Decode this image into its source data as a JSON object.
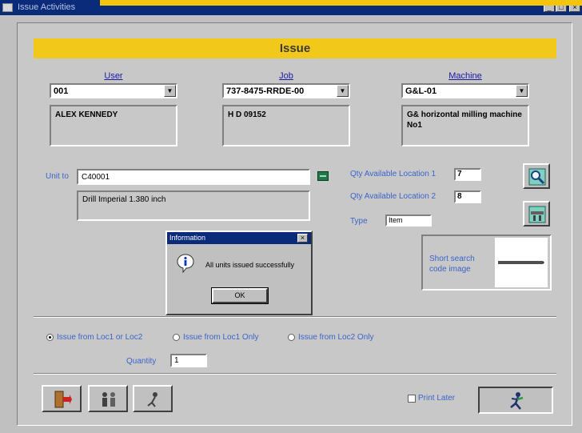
{
  "window": {
    "title": "Issue Activities",
    "controls": [
      "_",
      "□",
      "×"
    ]
  },
  "header": {
    "title": "Issue"
  },
  "user": {
    "label": "User",
    "value": "001",
    "description": "ALEX KENNEDY"
  },
  "job": {
    "label": "Job",
    "value": "737-8475-RRDE-00",
    "description": "H D 09152"
  },
  "machine": {
    "label": "Machine",
    "value": "G&L-01",
    "description": "G& horizontal milling machine No1"
  },
  "unit": {
    "label": "Unit to",
    "value": "C40001",
    "description": "Drill Imperial 1.380 inch"
  },
  "stock": {
    "qty_loc1_label": "Qty Available Location 1",
    "qty_loc1_value": "7",
    "qty_loc2_label": "Qty Available Location 2",
    "qty_loc2_value": "8",
    "type_label": "Type",
    "type_value": "Item"
  },
  "image_panel": {
    "label": "Short search code image"
  },
  "dialog": {
    "title": "Information",
    "close": "×",
    "message": "All units issued successfully",
    "ok_label": "OK"
  },
  "issue_options": {
    "options": [
      "Issue from Loc1 or Loc2",
      "Issue from Loc1 Only",
      "Issue from Loc2 Only"
    ],
    "selected": 0
  },
  "quantity": {
    "label": "Quantity",
    "value": "1"
  },
  "print_later": {
    "label": "Print Later",
    "checked": false
  },
  "icons": {
    "zoom": "magnifier-icon",
    "tool": "tool-icon",
    "exit": "exit-door-icon",
    "users": "users-icon",
    "person": "person-icon",
    "issue": "running-man-icon",
    "info": "info-icon"
  }
}
